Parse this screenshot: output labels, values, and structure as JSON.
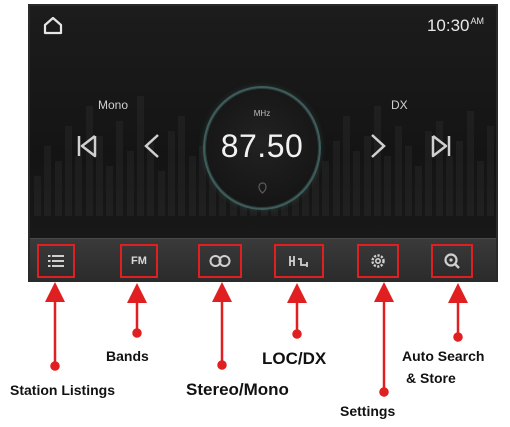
{
  "status_bar": {
    "home_icon": "home-icon",
    "time": "10:30",
    "ampm": "AM"
  },
  "radio": {
    "left_label": "Mono",
    "right_label": "DX",
    "band": "MHz",
    "frequency": "87.50"
  },
  "toolbar": {
    "buttons": [
      {
        "icon": "station-list-icon"
      },
      {
        "label": "FM"
      },
      {
        "icon": "stereo-mono-icon"
      },
      {
        "icon": "loc-dx-icon"
      },
      {
        "icon": "settings-icon"
      },
      {
        "icon": "auto-search-icon"
      }
    ]
  },
  "annotations": {
    "station_listings": "Station Listings",
    "bands": "Bands",
    "stereo_mono": "Stereo/Mono",
    "loc_dx": "LOC/DX",
    "settings": "Settings",
    "auto_search_line1": "Auto Search",
    "auto_search_line2": "& Store"
  },
  "colors": {
    "annotation_red": "#e02020",
    "accent_dial": "#3f5d5a"
  }
}
